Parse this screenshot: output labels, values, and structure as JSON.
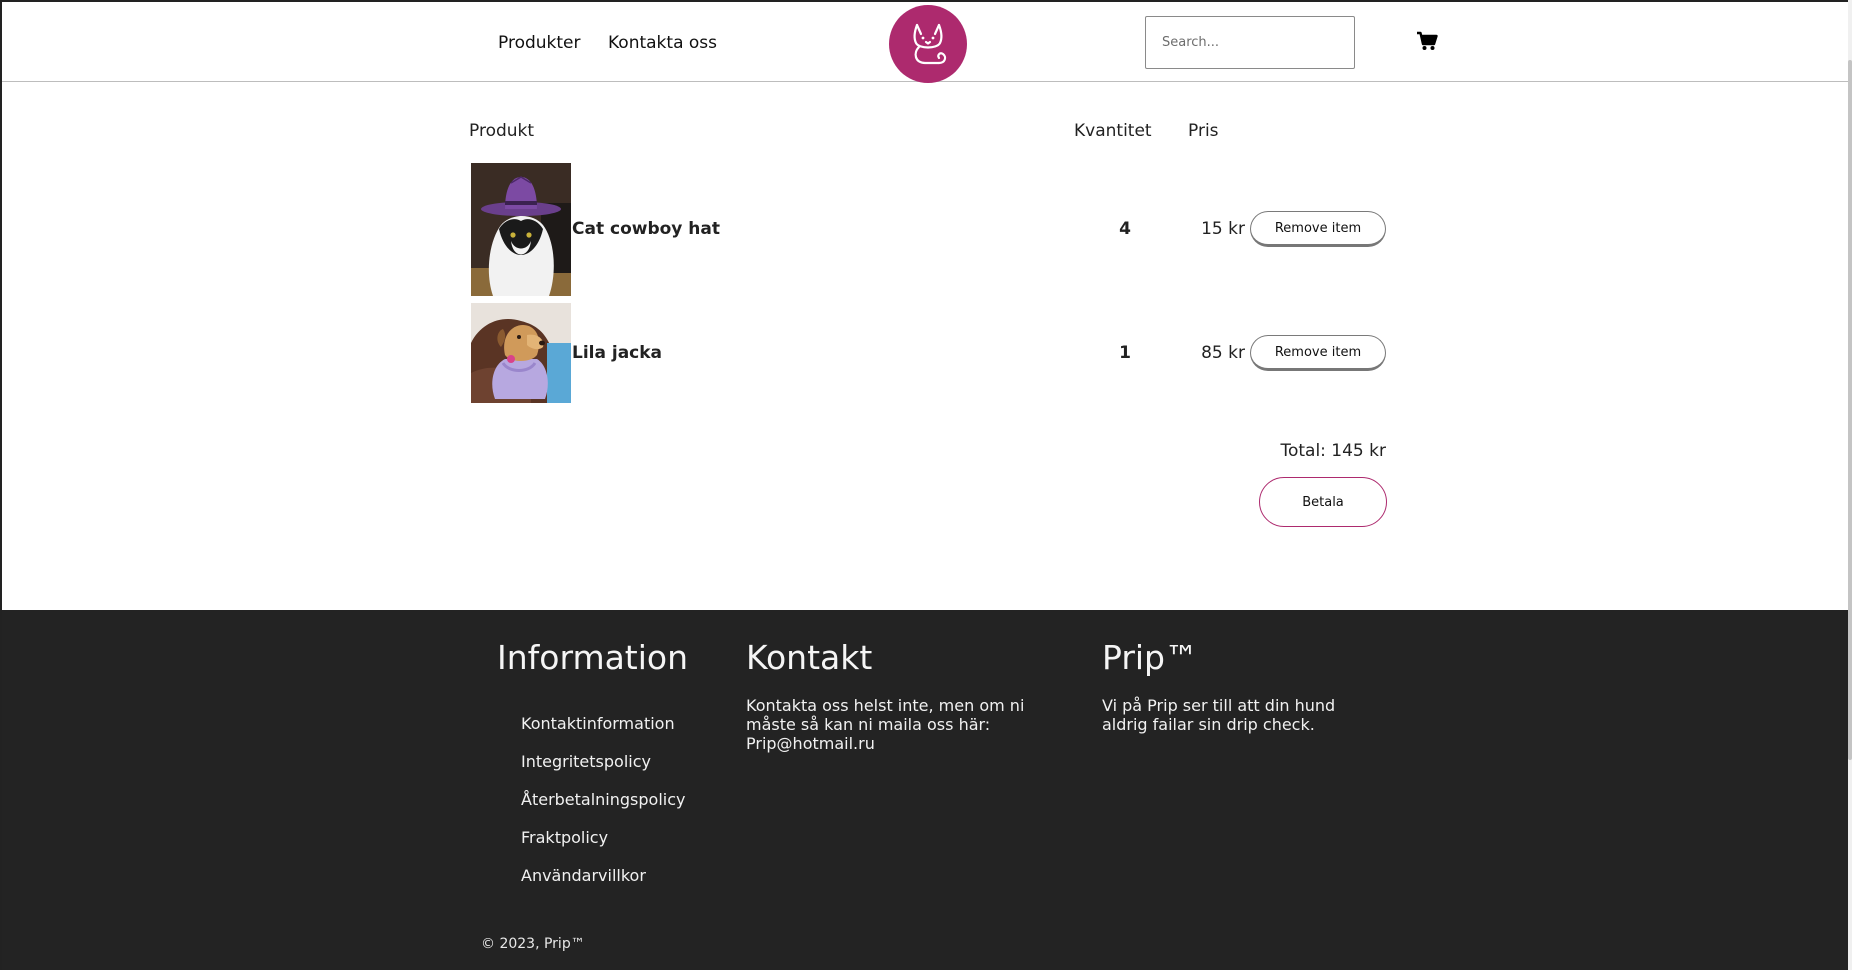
{
  "header": {
    "nav": [
      {
        "label": "Produkter"
      },
      {
        "label": "Kontakta oss"
      }
    ],
    "logo_icon": "cat-logo-icon",
    "search_placeholder": "Search...",
    "cart_icon": "shopping-cart-icon"
  },
  "cart": {
    "headers": {
      "product": "Produkt",
      "quantity": "Kvantitet",
      "price": "Pris"
    },
    "items": [
      {
        "name": "Cat cowboy hat",
        "quantity": "4",
        "price": "15 kr",
        "remove_label": "Remove item",
        "image": "cat-in-purple-cowboy-hat"
      },
      {
        "name": "Lila jacka",
        "quantity": "1",
        "price": "85 kr",
        "remove_label": "Remove item",
        "image": "dog-in-lilac-jacket"
      }
    ],
    "total": "Total: 145 kr",
    "pay_label": "Betala"
  },
  "footer": {
    "information": {
      "title": "Information",
      "links": [
        "Kontaktinformation",
        "Integritetspolicy",
        "Återbetalningspolicy",
        "Fraktpolicy",
        "Användarvillkor"
      ]
    },
    "kontakt": {
      "title": "Kontakt",
      "text": "Kontakta oss helst inte, men om ni måste så kan ni maila oss här: Prip@hotmail.ru"
    },
    "prip": {
      "title": "Prip™",
      "text": "Vi på Prip ser till att din hund aldrig failar sin drip check."
    },
    "copyright": "© 2023, Prip™"
  },
  "colors": {
    "brand": "#ad2a6e",
    "footer_bg": "#232323"
  }
}
